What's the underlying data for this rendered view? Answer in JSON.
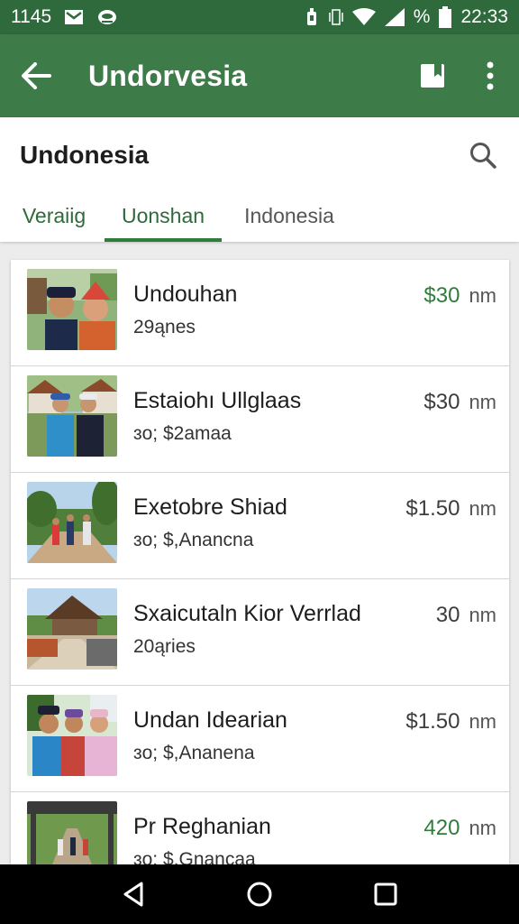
{
  "status_bar": {
    "left_time": "1145",
    "battery_percent": "%",
    "clock": "22:33",
    "icons": [
      "mail-icon",
      "notification-app-icon",
      "alarm-icon",
      "vibrate-icon",
      "wifi-icon",
      "signal-icon",
      "battery-icon"
    ]
  },
  "app_bar": {
    "title": "Undorvesia",
    "back_icon": "arrow-left-icon",
    "action_icons": [
      "bookmark-icon",
      "more-vert-icon"
    ]
  },
  "header": {
    "title": "Undonesia",
    "search_icon": "search-icon"
  },
  "tabs": [
    {
      "label": "Veraiig",
      "active": false
    },
    {
      "label": "Uonshan",
      "active": true
    },
    {
      "label": "Indonesia",
      "active": false
    }
  ],
  "accent_color": "#3d7c48",
  "items": [
    {
      "name": "Undouhan",
      "sub": "29ąnes",
      "price": "$30",
      "unit": "nm",
      "price_green": true,
      "thumb": "people-selfie-photo"
    },
    {
      "name": "Estaiohı Ullglaas",
      "sub": "ɜo; $2amaa",
      "price": "$30",
      "unit": "nm",
      "price_green": false,
      "thumb": "two-men-village-photo"
    },
    {
      "name": "Exetobre Shiad",
      "sub": "ɜo; $,Anancna",
      "price": "$1.50",
      "unit": "nm",
      "price_green": false,
      "thumb": "group-road-photo"
    },
    {
      "name": "Sxaicutaln Kior Verrlad",
      "sub": "20ąries",
      "price": "30",
      "unit": "nm",
      "price_green": false,
      "thumb": "pavilion-photo"
    },
    {
      "name": "Undan Idearian",
      "sub": "ɜo; $,Ananena",
      "price": "$1.50",
      "unit": "nm",
      "price_green": false,
      "thumb": "four-people-photo"
    },
    {
      "name": "Pr Reghanian",
      "sub": "ɜo; $,Gnancaa",
      "price": "420",
      "unit": "nm",
      "price_green": true,
      "thumb": "covered-walkway-photo"
    }
  ],
  "nav_bar": {
    "icons": [
      "back-triangle-icon",
      "home-circle-icon",
      "recents-square-icon"
    ]
  }
}
